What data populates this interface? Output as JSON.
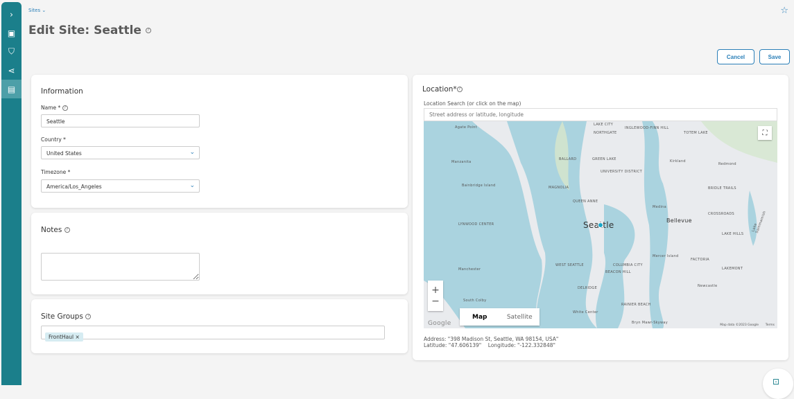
{
  "breadcrumb": "Sites",
  "page_title": "Edit Site: Seattle",
  "buttons": {
    "cancel": "Cancel",
    "save": "Save"
  },
  "information": {
    "heading": "Information",
    "name_label": "Name *",
    "name_value": "Seattle",
    "country_label": "Country *",
    "country_value": "United States",
    "timezone_label": "Timezone *",
    "timezone_value": "America/Los_Angeles"
  },
  "notes": {
    "heading": "Notes",
    "value": ""
  },
  "site_groups": {
    "heading": "Site Groups",
    "tags": [
      "FrontHaul"
    ]
  },
  "location": {
    "heading": "Location*",
    "search_label": "Location Search (or click on the map)",
    "search_placeholder": "Street address or latitude, longitude",
    "address": "Address: \"398 Madison St, Seattle, WA 98154, USA\"",
    "latitude": "Latitude: \"47.606139\"",
    "longitude": "Longitude: \"-122.332848\""
  },
  "map": {
    "type_map": "Map",
    "type_satellite": "Satellite",
    "attribution": "Map data ©2023 Google",
    "terms": "Terms",
    "logo": "Google",
    "city_label": "Seattle",
    "labels": [
      "Agate Point",
      "LAKE CITY",
      "INGLEWOOD-FINN HILL",
      "TOTEM LAKE",
      "NORTHGATE",
      "Manzanita",
      "BALLARD",
      "GREEN LAKE",
      "Kirkland",
      "Redmond",
      "UNIVERSITY DISTRICT",
      "Bainbridge Island",
      "MAGNOLIA",
      "BRIDLE TRAILS",
      "QUEEN ANNE",
      "Medina",
      "Bellevue",
      "CROSSROADS",
      "LYNWOOD CENTER",
      "LAKE HILLS",
      "Lake Sammamish",
      "WEST SEATTLE",
      "COLUMBIA CITY",
      "Mercer Island",
      "FACTORIA",
      "BEACON HILL",
      "LAKEMONT",
      "Manchester",
      "DELRIDGE",
      "Newcastle",
      "South Colby",
      "RAINIER BEACH",
      "White Center",
      "Bryn Mawr-Skyway"
    ]
  },
  "colors": {
    "sidebar": "#1b7f8b",
    "accent": "#2a7fb8",
    "water": "#aad3df"
  }
}
